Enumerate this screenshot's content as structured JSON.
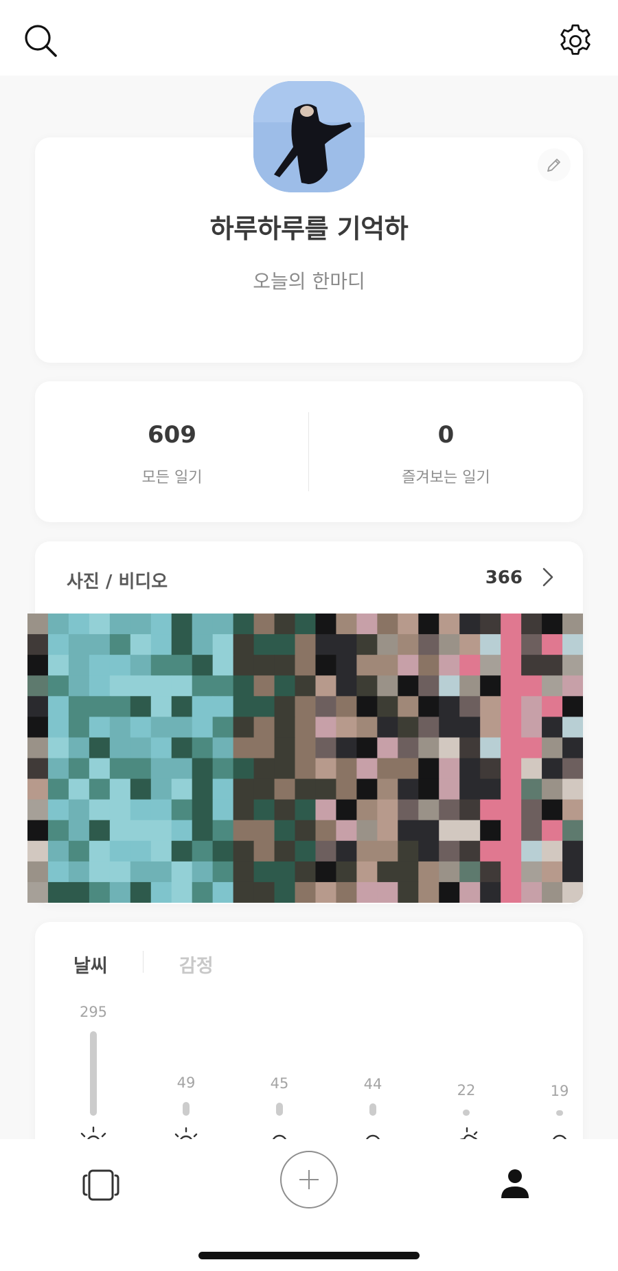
{
  "header": {
    "search_icon": "search-icon",
    "settings_icon": "gear-icon"
  },
  "profile": {
    "name": "하루하루를 기억하",
    "motto": "오늘의 한마디",
    "edit_icon": "pencil-icon",
    "avatar": "profile-photo"
  },
  "stats": {
    "all_count": "609",
    "all_label": "모든 일기",
    "fav_count": "0",
    "fav_label": "즐겨보는 일기"
  },
  "media": {
    "title": "사진 / 비디오",
    "count": "366"
  },
  "chart": {
    "tabs": [
      {
        "label": "날씨",
        "active": true
      },
      {
        "label": "감정",
        "active": false
      }
    ]
  },
  "chart_data": {
    "type": "bar",
    "categories": [
      "sunny",
      "partly-sunny",
      "cloudy-1",
      "cloudy-2",
      "sun-behind-cloud",
      "cloudy-3"
    ],
    "values": [
      295,
      49,
      45,
      44,
      22,
      19
    ],
    "title": "",
    "xlabel": "",
    "ylabel": ""
  },
  "bottom_nav": {
    "items": [
      {
        "icon": "diary-cards-icon"
      },
      {
        "icon": "plus-icon"
      },
      {
        "icon": "person-icon"
      }
    ]
  },
  "colors": {
    "background": "#f8f8f8",
    "card": "#ffffff",
    "text_primary": "#3a3a3a",
    "text_secondary": "#8e8e8e",
    "bar": "#cccccc"
  }
}
